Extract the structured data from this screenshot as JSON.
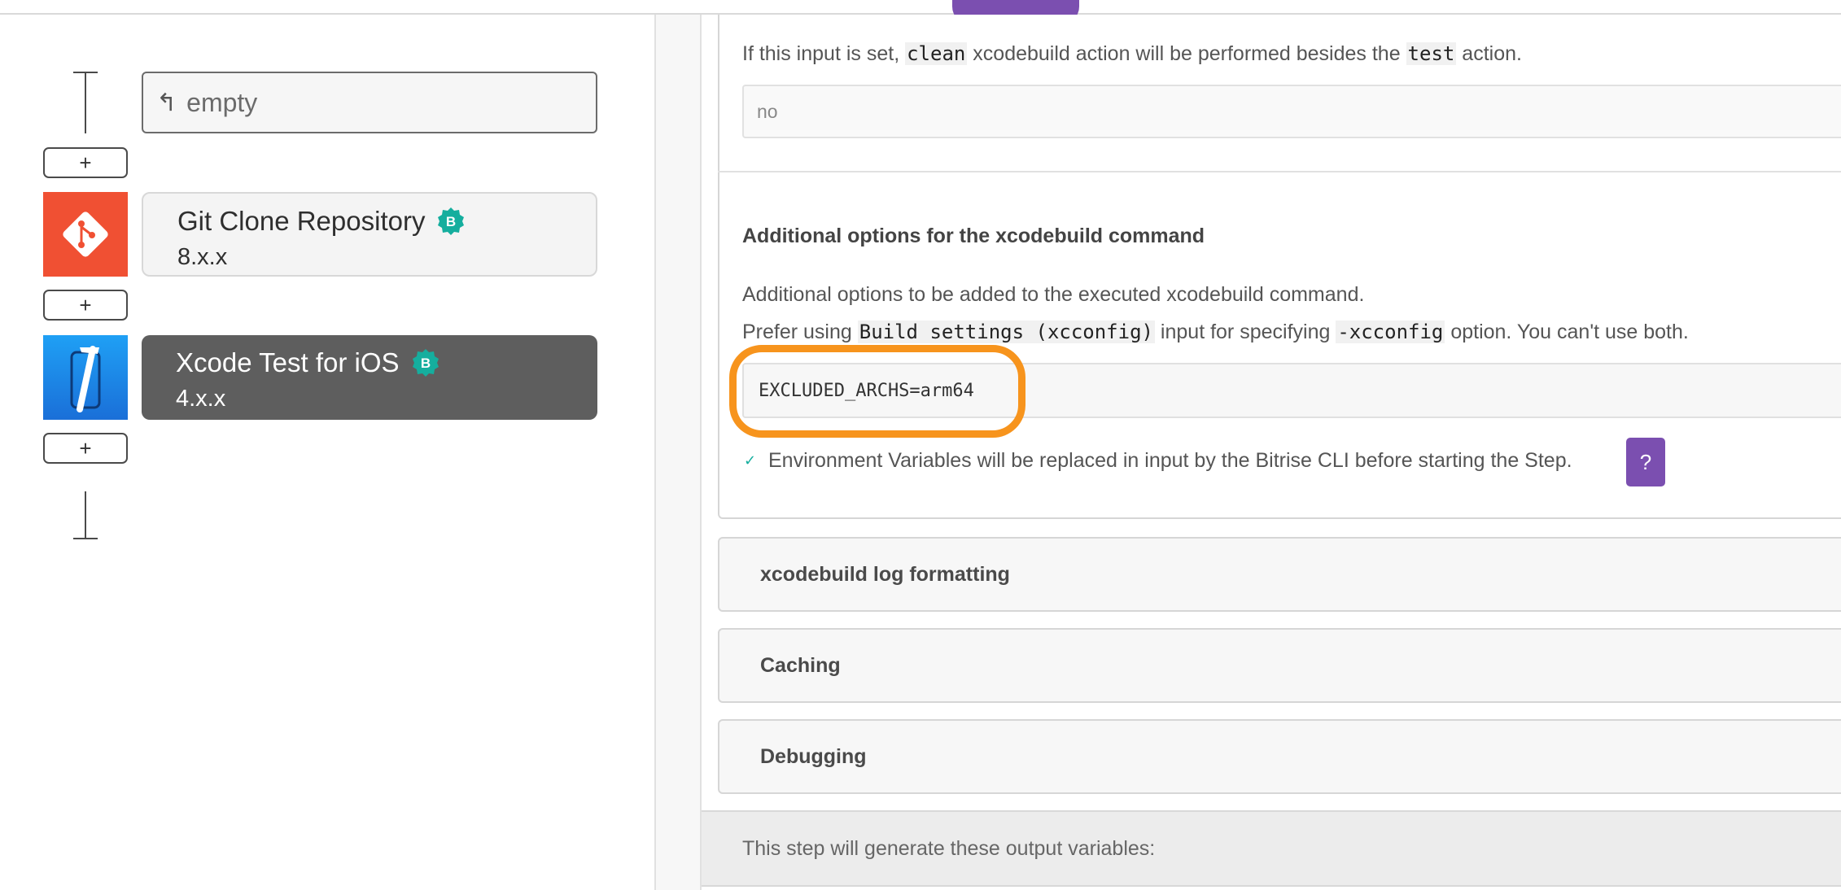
{
  "workflow": {
    "empty_label": "empty",
    "add_symbol": "+",
    "steps": [
      {
        "title": "Git Clone Repository",
        "version": "8.x.x",
        "badge": "B",
        "icon": "git-icon",
        "color": "#f05033"
      },
      {
        "title": "Xcode Test for iOS",
        "version": "4.x.x",
        "badge": "B",
        "icon": "xcode-icon",
        "color": "#1a8ced"
      }
    ],
    "badge_color": "#15ae9e"
  },
  "clean_input": {
    "desc_prefix": "If this input is set, ",
    "desc_code1": "clean",
    "desc_middle": " xcodebuild action will be performed besides the ",
    "desc_code2": "test",
    "desc_suffix": " action.",
    "value": "no"
  },
  "xcodebuild_options": {
    "title": "Additional options for the xcodebuild command",
    "desc_line1": "Additional options to be added to the executed xcodebuild command.",
    "desc_line2_prefix": "Prefer using ",
    "desc_line2_code1": "Build settings (xcconfig)",
    "desc_line2_middle": " input for specifying ",
    "desc_line2_code2": "-xcconfig",
    "desc_line2_suffix": " option. You can't use both.",
    "value": "EXCLUDED_ARCHS=arm64",
    "env_note": "Environment Variables will be replaced in input by the Bitrise CLI before starting the Step.",
    "help_label": "?",
    "check_symbol": "✓",
    "highlight_color": "#f7941d"
  },
  "sections": [
    {
      "label": "xcodebuild log formatting"
    },
    {
      "label": "Caching"
    },
    {
      "label": "Debugging"
    }
  ],
  "outputs_text": "This step will generate these output variables:",
  "accent_color": "#7b4fb0"
}
